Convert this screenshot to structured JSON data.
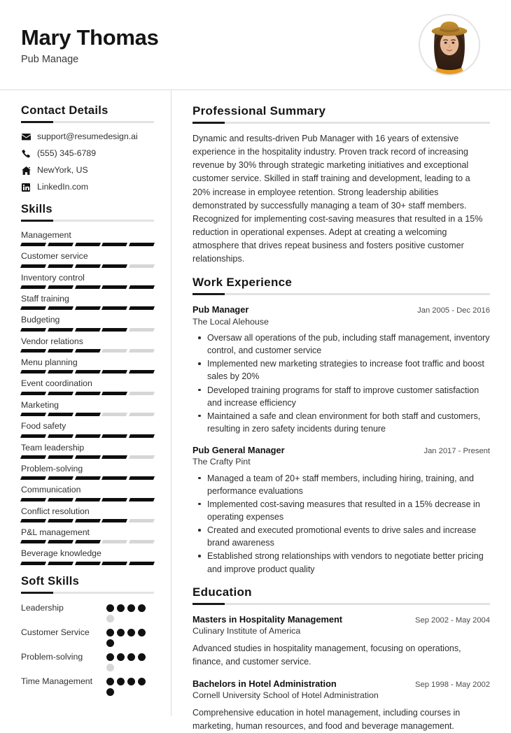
{
  "header": {
    "full_name": "Mary Thomas",
    "job_title": "Pub Manage",
    "avatar_alt": "profile-photo"
  },
  "sidebar": {
    "contact": {
      "heading": "Contact Details",
      "items": [
        {
          "icon": "envelope-icon",
          "value": "support@resumedesign.ai"
        },
        {
          "icon": "phone-icon",
          "value": "(555) 345-6789"
        },
        {
          "icon": "home-icon",
          "value": "NewYork, US"
        },
        {
          "icon": "linkedin-icon",
          "value": "LinkedIn.com"
        }
      ]
    },
    "skills": {
      "heading": "Skills",
      "max_level": 5,
      "items": [
        {
          "label": "Management",
          "level": 5
        },
        {
          "label": "Customer service",
          "level": 4
        },
        {
          "label": "Inventory control",
          "level": 5
        },
        {
          "label": "Staff training",
          "level": 5
        },
        {
          "label": "Budgeting",
          "level": 4
        },
        {
          "label": "Vendor relations",
          "level": 3
        },
        {
          "label": "Menu planning",
          "level": 5
        },
        {
          "label": "Event coordination",
          "level": 4
        },
        {
          "label": "Marketing",
          "level": 3
        },
        {
          "label": "Food safety",
          "level": 5
        },
        {
          "label": "Team leadership",
          "level": 4
        },
        {
          "label": "Problem-solving",
          "level": 5
        },
        {
          "label": "Communication",
          "level": 5
        },
        {
          "label": "Conflict resolution",
          "level": 4
        },
        {
          "label": "P&L management",
          "level": 3
        },
        {
          "label": "Beverage knowledge",
          "level": 5
        }
      ]
    },
    "soft_skills": {
      "heading": "Soft Skills",
      "max_level": 5,
      "items": [
        {
          "label": "Leadership",
          "level": 4
        },
        {
          "label": "Customer Service",
          "level": 5
        },
        {
          "label": "Problem-solving",
          "level": 4
        },
        {
          "label": "Time Management",
          "level": 5
        }
      ]
    }
  },
  "main": {
    "summary": {
      "heading": "Professional Summary",
      "text": "Dynamic and results-driven Pub Manager with 16 years of extensive experience in the hospitality industry. Proven track record of increasing revenue by 30% through strategic marketing initiatives and exceptional customer service. Skilled in staff training and development, leading to a 20% increase in employee retention. Strong leadership abilities demonstrated by successfully managing a team of 30+ staff members. Recognized for implementing cost-saving measures that resulted in a 15% reduction in operational expenses. Adept at creating a welcoming atmosphere that drives repeat business and fosters positive customer relationships."
    },
    "work": {
      "heading": "Work Experience",
      "entries": [
        {
          "title": "Pub Manager",
          "date": "Jan 2005 - Dec 2016",
          "org": "The Local Alehouse",
          "bullets": [
            "Oversaw all operations of the pub, including staff management, inventory control, and customer service",
            "Implemented new marketing strategies to increase foot traffic and boost sales by 20%",
            "Developed training programs for staff to improve customer satisfaction and increase efficiency",
            "Maintained a safe and clean environment for both staff and customers, resulting in zero safety incidents during tenure"
          ]
        },
        {
          "title": "Pub General Manager",
          "date": "Jan 2017 - Present",
          "org": "The Crafty Pint",
          "bullets": [
            "Managed a team of 20+ staff members, including hiring, training, and performance evaluations",
            "Implemented cost-saving measures that resulted in a 15% decrease in operating expenses",
            "Created and executed promotional events to drive sales and increase brand awareness",
            "Established strong relationships with vendors to negotiate better pricing and improve product quality"
          ]
        }
      ]
    },
    "education": {
      "heading": "Education",
      "entries": [
        {
          "title": "Masters in Hospitality Management",
          "date": "Sep 2002 - May 2004",
          "org": "Culinary Institute of America",
          "desc": "Advanced studies in hospitality management, focusing on operations, finance, and customer service."
        },
        {
          "title": "Bachelors in Hotel Administration",
          "date": "Sep 1998 - May 2002",
          "org": "Cornell University School of Hotel Administration",
          "desc": "Comprehensive education in hotel management, including courses in marketing, human resources, and food and beverage management."
        }
      ]
    }
  },
  "theme": {
    "accent": "#1a1a1a",
    "rule_light": "#e3e3e3",
    "bar_on": "#0e0e0e",
    "bar_off": "#d6d6d6",
    "divider": "#dcdcdc"
  }
}
